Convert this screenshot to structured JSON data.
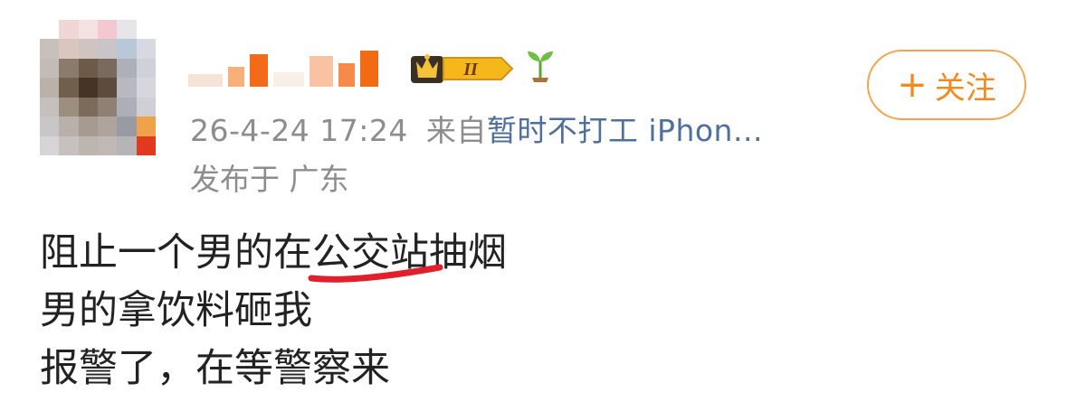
{
  "post": {
    "timestamp": "26-4-24 17:24",
    "source_prefix": "来自",
    "source_device": "暂时不打工 iPhon...",
    "location": "发布于 广东",
    "follow_label": "关注",
    "follow_plus": "+",
    "vip_level": "II",
    "lines": [
      "阻止一个男的在公交站抽烟",
      "男的拿饮料砸我",
      "报警了，在等警察来"
    ]
  },
  "colors": {
    "follow_accent": "#f28a20",
    "source_link": "#4f6f9d",
    "underline": "#e0212b"
  },
  "icons": {
    "avatar": "pixelated-avatar",
    "badge": "vip-crown-badge-icon",
    "sprout": "sprout-icon"
  }
}
